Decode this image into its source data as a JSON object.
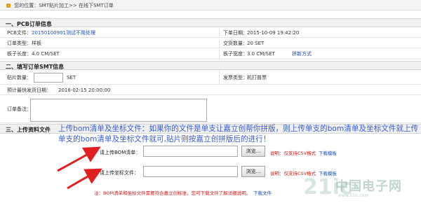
{
  "breadcrumb": {
    "text": "您的位置：SMT贴片加工>> 在线下SMT订单"
  },
  "sections": {
    "pcb_info": "一、PCB订单信息",
    "fill_smt": "二、填写订单SMT信息",
    "upload": "三、上传资料文件"
  },
  "pcb_info": {
    "pcb_file_label": "PCB文件：",
    "pcb_file_value": "20150100901测试不用处理",
    "order_date_label": "下单日期：",
    "order_date_value": "2015-10-09 19:42:20",
    "order_type_label": "订单类型：",
    "order_type_value": "样板",
    "delivery_qty_label": "交货数量：",
    "delivery_qty_value": "20 SET",
    "board_length_label": "板子长度：",
    "board_length_value": "4.0 CM/SET",
    "board_width_label": "板子宽度：",
    "board_width_value": "3.0 CM/SET",
    "panel_method": "拼新方式"
  },
  "smt_info": {
    "patch_qty_label": "贴片数量：",
    "patch_qty_value": "",
    "patch_qty_unit": "SET",
    "invoice_label": "发票类型：",
    "invoice_value": "机打普票",
    "expected_date_label": "预计最快发货日期：",
    "expected_date_value": "2016-02-15 20:00:00",
    "remark_label": "订单备注："
  },
  "upload": {
    "notice": "上传bom清单及坐标文件：如果你的文件是单支让嘉立创帮你拼版，则上传单支的bom清单及坐标文件就上传单支的bom清单及坐标文件就可,贴片则按嘉立创拼版后的进行！",
    "bom_label": "请上传BOM清单：",
    "bom_value": "",
    "coord_label": "请上传坐标文件：",
    "coord_value": "",
    "browse_label": "浏览...",
    "note_csv": "说明：仅支持CSV格式",
    "download_template": "下载模板",
    "footer_note": "注：BOM清单和坐标文件需要符合嘉立创标准，您可下载文件了解详细说明。",
    "footer_download": "下载文件"
  },
  "watermark": {
    "logo": "21ic",
    "text": "中国电子网",
    "sub": "www.21ic.com"
  },
  "colors": {
    "link_blue": "#1a4fb4",
    "notice_blue": "#3a5bd8",
    "alert_red": "#d01818",
    "section_bg": "#f0f0f0",
    "arrow_red": "#e02020"
  }
}
